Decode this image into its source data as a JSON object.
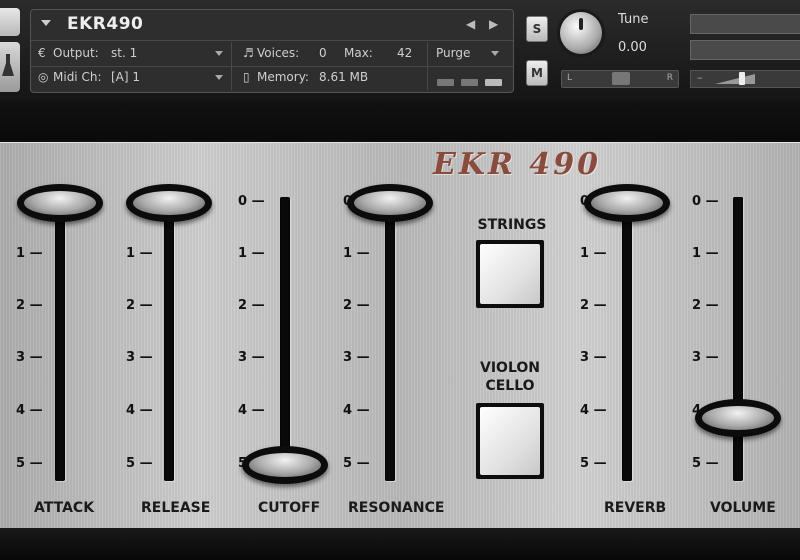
{
  "header": {
    "instrument_name": "EKR490",
    "prev_icon": "triangle-left-icon",
    "next_icon": "triangle-right-icon",
    "output_label": "Output:",
    "output_value": "st. 1",
    "midi_label": "Midi Ch:",
    "midi_value": "[A] 1",
    "voices_label": "Voices:",
    "voices_value": "0",
    "max_label": "Max:",
    "max_value": "42",
    "memory_label": "Memory:",
    "memory_value": "8.61 MB",
    "purge_label": "Purge",
    "solo_label": "S",
    "mute_label": "M",
    "tune_label": "Tune",
    "tune_value": "0.00",
    "pan_left": "L",
    "pan_right": "R",
    "volume_minus": "–"
  },
  "panel": {
    "brand": "EKR 490",
    "faders": [
      {
        "label": "ATTACK",
        "ticks": [
          "1",
          "2",
          "3",
          "4",
          "5"
        ],
        "value": 0
      },
      {
        "label": "RELEASE",
        "ticks": [
          "1",
          "2",
          "3",
          "4",
          "5"
        ],
        "value": 0
      },
      {
        "label": "CUTOFF",
        "ticks": [
          "0",
          "1",
          "2",
          "3",
          "4",
          "5"
        ],
        "value": 5
      },
      {
        "label": "RESONANCE",
        "ticks": [
          "0",
          "1",
          "2",
          "3",
          "4",
          "5"
        ],
        "value": 0
      },
      {
        "label": "REVERB",
        "ticks": [
          "0",
          "1",
          "2",
          "3",
          "4",
          "5"
        ],
        "value": 0
      },
      {
        "label": "VOLUME",
        "ticks": [
          "0",
          "1",
          "2",
          "3",
          "4",
          "5"
        ],
        "value": 4.1
      }
    ],
    "switches": [
      {
        "label": "STRINGS"
      },
      {
        "label": "VIOLON CELLO"
      }
    ]
  },
  "colors": {
    "brand_text": "#8a4a3c",
    "panel_metal": "#c4c4c4",
    "header_bg": "#2e2e2e"
  }
}
